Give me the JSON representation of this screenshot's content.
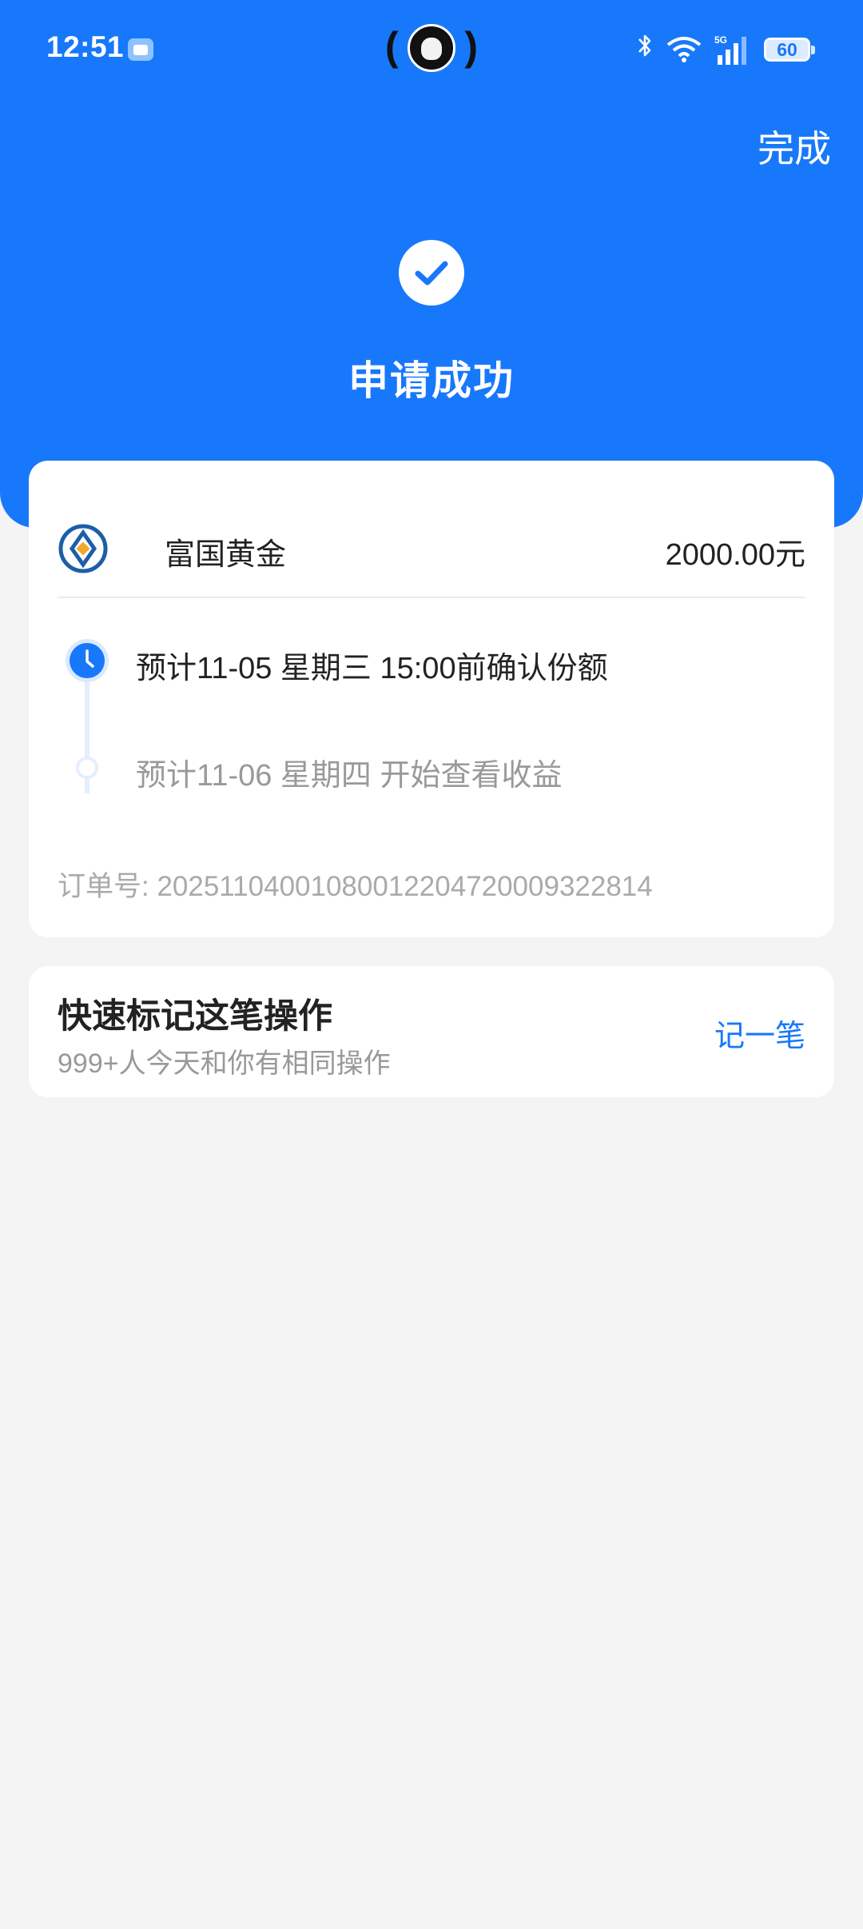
{
  "status_bar": {
    "time": "12:51",
    "battery": "60",
    "icons": [
      "notification-app-icon",
      "avatar",
      "bluetooth-icon",
      "wifi-icon",
      "signal-5g-icon",
      "battery-icon"
    ]
  },
  "header": {
    "done_label": "完成",
    "success_title": "申请成功",
    "check_icon": "check-circle-icon",
    "background_color": "#1878fb"
  },
  "order": {
    "fund_name": "富国黄金",
    "amount": "2000.00元",
    "timeline": [
      {
        "text": "预计11-05 星期三 15:00前确认份额",
        "state": "active"
      },
      {
        "text": "预计11-06 星期四 开始查看收益",
        "state": "pending"
      }
    ],
    "order_number": "订单号: 20251104001080012204720009322814"
  },
  "quick_mark": {
    "title": "快速标记这笔操作",
    "subtitle": "999+人今天和你有相同操作",
    "action_label": "记一笔",
    "accent_color": "#1878fb"
  }
}
